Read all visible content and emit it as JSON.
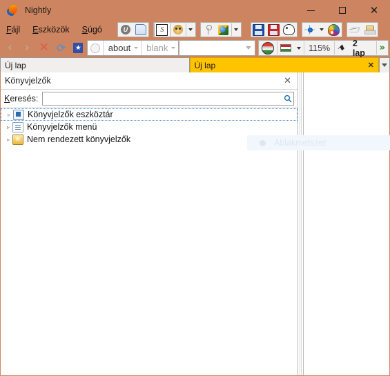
{
  "window": {
    "title": "Nightly",
    "app_icon": "firefox-nightly-icon",
    "controls": {
      "minimize": "—",
      "maximize": "□",
      "close": "✕"
    },
    "titlebar_color": "#cd8460"
  },
  "menu": {
    "items": [
      {
        "label": "Fájl",
        "accel": "F",
        "name": "menu-file"
      },
      {
        "label": "Eszközök",
        "accel": "E",
        "name": "menu-tools"
      },
      {
        "label": "Súgó",
        "accel": "S",
        "name": "menu-help"
      }
    ]
  },
  "toolbar": {
    "groups": [
      {
        "name": "group-userscripts",
        "buttons": [
          {
            "name": "greasemonkey-button",
            "icon": "circle-u-icon",
            "label": "U"
          },
          {
            "name": "scriptish-button",
            "icon": "scroll-icon"
          }
        ]
      },
      {
        "name": "group-stylish",
        "buttons": [
          {
            "name": "stylish-button",
            "icon": "letter-s-icon",
            "label": "S"
          },
          {
            "name": "monkey-button",
            "icon": "monkey-face-icon"
          },
          {
            "name": "monkey-dropdown",
            "icon": "chevron-down-icon"
          }
        ]
      },
      {
        "name": "group-keys",
        "buttons": [
          {
            "name": "key-button",
            "icon": "key-icon"
          },
          {
            "name": "globe-page-button",
            "icon": "globe-page-icon"
          },
          {
            "name": "globe-dropdown",
            "icon": "chevron-down-icon"
          }
        ]
      },
      {
        "name": "group-save",
        "buttons": [
          {
            "name": "save-blue-button",
            "icon": "floppy-blue-icon"
          },
          {
            "name": "save-red-button",
            "icon": "floppy-red-icon"
          },
          {
            "name": "palette-mono-button",
            "icon": "palette-outline-icon"
          }
        ]
      },
      {
        "name": "group-tools",
        "buttons": [
          {
            "name": "devtools-button",
            "icon": "node-graph-icon"
          },
          {
            "name": "devtools-dropdown",
            "icon": "chevron-down-icon"
          },
          {
            "name": "colorpicker-button",
            "icon": "rainbow-palette-icon"
          }
        ]
      },
      {
        "name": "group-send",
        "buttons": [
          {
            "name": "send-page-button",
            "icon": "paper-plane-icon"
          },
          {
            "name": "stamp-button",
            "icon": "stamp-icon"
          }
        ]
      }
    ]
  },
  "navbar": {
    "back": {
      "name": "back-button",
      "icon": "chevron-left-icon",
      "glyph": "‹"
    },
    "forward": {
      "name": "forward-button",
      "icon": "chevron-right-icon",
      "glyph": "›"
    },
    "stop": {
      "name": "stop-button",
      "icon": "close-x-icon",
      "glyph": "✕"
    },
    "reload": {
      "name": "reload-button",
      "icon": "reload-icon",
      "glyph": "⟳"
    },
    "bookmarks_toggle": {
      "name": "bookmarks-sidebar-button",
      "icon": "bookmark-book-icon"
    },
    "address": {
      "name": "address-bar",
      "favicon": "globe-icon",
      "segments": [
        {
          "text": "about",
          "name": "url-segment-scheme",
          "muted": false
        },
        {
          "text": "blank",
          "name": "url-segment-path",
          "muted": true
        }
      ]
    },
    "search": {
      "name": "search-bar",
      "value": "",
      "placeholder": ""
    },
    "right_tools": [
      {
        "name": "translate-button",
        "icon": "hungary-globe-icon"
      },
      {
        "name": "language-button",
        "icon": "hungary-flag-icon"
      },
      {
        "name": "language-dropdown",
        "icon": "chevron-down-icon"
      }
    ],
    "zoom_level": "115%",
    "zoom_name": "zoom-level-indicator",
    "pin": {
      "name": "pin-button",
      "icon": "pin-icon",
      "glyph": "⚑"
    },
    "tab_count": {
      "name": "tab-count-indicator",
      "label": "2 lap"
    },
    "overflow": {
      "name": "toolbar-overflow-button",
      "icon": "double-chevron-right-icon",
      "glyph": "»"
    }
  },
  "tabs": {
    "items": [
      {
        "label": "Új lap",
        "active": false,
        "name": "tab-uj-lap-1",
        "close": ""
      },
      {
        "label": "Új lap",
        "active": true,
        "name": "tab-uj-lap-2",
        "close": "✕"
      }
    ],
    "list_button": {
      "name": "tab-list-button",
      "icon": "chevron-down-icon"
    },
    "active_color": "#ffc400"
  },
  "sidebar": {
    "title": "Könyvjelzők",
    "close_label": "✕",
    "search": {
      "label": "Keresés:",
      "accel": "K",
      "value": "",
      "placeholder": "",
      "icon": "magnifier-icon"
    },
    "tree": [
      {
        "label": "Könyvjelzők eszköztár",
        "icon": "bookmarks-toolbar-folder-icon",
        "twisty": "▹",
        "selected": true,
        "name": "tree-item-bookmarks-toolbar"
      },
      {
        "label": "Könyvjelzők menü",
        "icon": "bookmarks-menu-folder-icon",
        "twisty": "▹",
        "selected": false,
        "name": "tree-item-bookmarks-menu"
      },
      {
        "label": "Nem rendezett könyvjelzők",
        "icon": "unsorted-bookmarks-folder-icon",
        "twisty": "▹",
        "selected": false,
        "name": "tree-item-unsorted-bookmarks"
      }
    ]
  },
  "overlay": {
    "watermark_text": "Ablakmetszet",
    "watermark_icon": "dot-icon"
  }
}
